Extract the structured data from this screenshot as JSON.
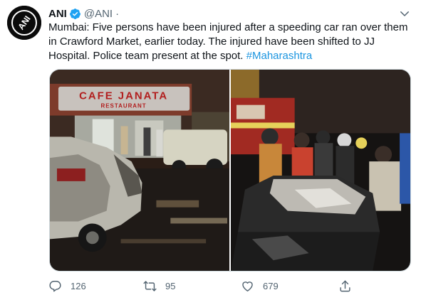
{
  "tweet": {
    "author_name": "ANI",
    "author_handle": "@ANI",
    "separator": "·",
    "body_text": "Mumbai: Five persons have been injured after a speeding car ran over them in Crawford Market, earlier today. The injured have been shifted to JJ Hospital. Police team present at the spot. ",
    "hashtag": "#Maharashtra",
    "avatar_logo_text": "ANI"
  },
  "media": {
    "left_photo_signage": "CAFE JANATA",
    "left_photo_subsign": "RESTAURANT"
  },
  "actions": {
    "reply_count": "126",
    "retweet_count": "95",
    "like_count": "679"
  },
  "colors": {
    "hashtag": "#1b95e0",
    "verified": "#1da1f2",
    "muted_text": "#536471"
  },
  "icons": [
    "ani-logo-icon",
    "verified-badge-icon",
    "chevron-down-icon",
    "reply-icon",
    "retweet-icon",
    "like-icon",
    "share-icon"
  ]
}
